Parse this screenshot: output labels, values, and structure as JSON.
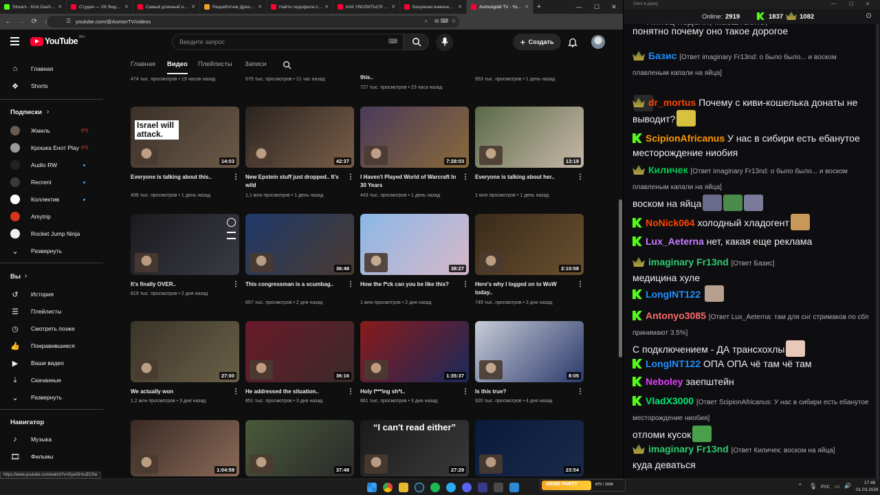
{
  "browser": {
    "tabs": [
      {
        "label": "Stream - Kick Dashboard",
        "color": "#53fc18"
      },
      {
        "label": "Студия — VK Видео Live",
        "color": "#ff0033"
      },
      {
        "label": "Самый длинный нос…",
        "color": "#ff0033"
      },
      {
        "label": "Разработчик Дреи…",
        "color": "#f0a020"
      },
      {
        "label": "Найти педофила по х…",
        "color": "#ff0033"
      },
      {
        "label": "КАК УВОЛИТЬСЯ И П…",
        "color": "#ff0033"
      },
      {
        "label": "Безумная инженерия…",
        "color": "#ff0033"
      },
      {
        "label": "Asmongold TV - YouTube",
        "color": "#ff0033"
      }
    ],
    "url": "youtube.com/@AsmonTV/videos",
    "status_url": "https://www.youtube.com/watch?v=GywSHzuEC0w"
  },
  "yt": {
    "logo": "YouTube",
    "region": "RU",
    "search_placeholder": "Введите запрос",
    "create_label": "Создать",
    "channel_tabs": [
      "Главная",
      "Видео",
      "Плейлисты",
      "Записи"
    ]
  },
  "sidebar": {
    "top": [
      {
        "label": "Главная",
        "icon": "home-icon"
      },
      {
        "label": "Shorts",
        "icon": "shorts-icon"
      }
    ],
    "subs_header": "Подписки",
    "subs": [
      {
        "label": "Жмиль",
        "live": true,
        "color": "#6b5a4e"
      },
      {
        "label": "Крошка Енот Play",
        "live": true,
        "color": "#9a9a9a"
      },
      {
        "label": "Audio RW",
        "dot": true,
        "color": "#222222"
      },
      {
        "label": "Recrent",
        "dot": true,
        "color": "#3a3a3a"
      },
      {
        "label": "Коллектив",
        "dot": true,
        "color": "#ffffff"
      },
      {
        "label": "Amytrip",
        "dot": false,
        "color": "#d4371c"
      },
      {
        "label": "Rocket Jump Ninja",
        "dot": false,
        "color": "#eeeeee"
      },
      {
        "label": "Развернуть",
        "expand": true
      }
    ],
    "you_header": "Вы",
    "you": [
      {
        "label": "История",
        "icon": "history-icon"
      },
      {
        "label": "Плейлисты",
        "icon": "playlists-icon"
      },
      {
        "label": "Смотреть позже",
        "icon": "watch-later-icon"
      },
      {
        "label": "Понравившиеся",
        "icon": "like-icon"
      },
      {
        "label": "Ваши видео",
        "icon": "your-videos-icon"
      },
      {
        "label": "Скачанные",
        "icon": "download-icon"
      },
      {
        "label": "Развернуть",
        "icon": "chevron-down-icon"
      }
    ],
    "nav_header": "Навигатор",
    "nav": [
      {
        "label": "Музыка",
        "icon": "music-icon"
      },
      {
        "label": "Фильмы",
        "icon": "movies-icon"
      }
    ]
  },
  "videos": {
    "row0": [
      {
        "meta": "474 тыс. просмотров • 19 часов назад"
      },
      {
        "meta": "679 тыс. просмотров • 21 час назад"
      },
      {
        "title_tail": "this..",
        "meta": "727 тыс. просмотров • 23 часа назад"
      },
      {
        "meta": "953 тыс. просмотров • 1 день назад"
      }
    ],
    "grid": [
      {
        "title": "Everyone is talking about this..",
        "meta": "499 тыс. просмотров • 1 день назад",
        "duration": "14:03",
        "overlay": "Israel will attack.",
        "bg1": "#3a3028",
        "bg2": "#6b5a48"
      },
      {
        "title": "New Epstein stuff just dropped.. It's wild",
        "meta": "1,1 млн просмотров • 1 день назад",
        "duration": "42:37",
        "overlay": "",
        "bg1": "#2a2420",
        "bg2": "#7a5e48"
      },
      {
        "title": "I Haven't Played World of Warcraft In 30 Years",
        "meta": "443 тыс. просмотров • 1 день назад",
        "duration": "7:28:03",
        "overlay": "",
        "bg1": "#4a3a5a",
        "bg2": "#8a6a3a"
      },
      {
        "title": "Everyone is talking about her..",
        "meta": "1 млн просмотров • 1 день назад",
        "duration": "13:19",
        "overlay": "",
        "bg1": "#5a6a48",
        "bg2": "#c8b8a8"
      },
      {
        "title": "It's finally OVER..",
        "meta": "819 тыс. просмотров • 2 дня назад",
        "duration": "",
        "overlay": "",
        "bg1": "#1a1a1e",
        "bg2": "#3a3a44"
      },
      {
        "title": "This congressman is a scumbag..",
        "meta": "657 тыс. просмотров • 2 дня назад",
        "duration": "36:48",
        "overlay": "",
        "bg1": "#1e3a6a",
        "bg2": "#4a3a30"
      },
      {
        "title": "How the f*ck can you be like this?",
        "meta": "1 млн просмотров • 2 дня назад",
        "duration": "38:27",
        "overlay": "",
        "bg1": "#8ab8e8",
        "bg2": "#d8b8c8"
      },
      {
        "title": "Here's why I logged on to WoW today..",
        "meta": "749 тыс. просмотров • 3 дня назад",
        "duration": "2:10:58",
        "overlay": "",
        "bg1": "#3a2a1a",
        "bg2": "#6a5030"
      },
      {
        "title": "We actually won",
        "meta": "1,2 млн просмотров • 3 дня назад",
        "duration": "27:00",
        "overlay": "",
        "bg1": "#3a3428",
        "bg2": "#6a6048"
      },
      {
        "title": "He addressed the situation..",
        "meta": "851 тыс. просмотров • 3 дня назад",
        "duration": "36:16",
        "overlay": "",
        "bg1": "#6a1a2a",
        "bg2": "#3a2a2a"
      },
      {
        "title": "Holy f***ing sh*t..",
        "meta": "861 тыс. просмотров • 3 дня назад",
        "duration": "1:35:37",
        "overlay": "",
        "bg1": "#8a1a1a",
        "bg2": "#1a2a5a"
      },
      {
        "title": "Is this true?",
        "meta": "920 тыс. просмотров • 4 дня назад",
        "duration": "8:05",
        "overlay": "",
        "bg1": "#c8ccd8",
        "bg2": "#2a3a6a"
      },
      {
        "title": "",
        "meta": "",
        "duration": "1:04:59",
        "overlay": "",
        "bg1": "#3a2a24",
        "bg2": "#8a6a58"
      },
      {
        "title": "",
        "meta": "",
        "duration": "37:48",
        "overlay": "",
        "bg1": "#4a5a3a",
        "bg2": "#2a2a2a"
      },
      {
        "title": "",
        "meta": "",
        "duration": "27:29",
        "overlay": "“I can't read either”",
        "bg1": "#1a1a1a",
        "bg2": "#3a3a3a"
      },
      {
        "title": "",
        "meta": "",
        "duration": "23:54",
        "overlay": "",
        "bg1": "#0a1a3a",
        "bg2": "#1a2a4a"
      }
    ]
  },
  "chat": {
    "window_title": "Окно в дерку",
    "online_label": "Online:",
    "online_count": "2919",
    "kick_count": "1837",
    "vk_count": "1082",
    "messages": [
      {
        "platform": "none",
        "user": "",
        "color": "#efeff1",
        "reply": "",
        "text": "понятно почему оно такое дорогое",
        "top_text": "Пипец неделя, масштабно,"
      },
      {
        "platform": "vk",
        "user": "Базис",
        "color": "#1e90ff",
        "reply": "[Ответ imaginary Fr13nd: о было было... и воском плавленым капали на яйца]",
        "text": ""
      },
      {
        "platform": "vk",
        "user": "dr_mortus",
        "color": "#ff4500",
        "reply": "",
        "text": "Почему с киви-кошелька донаты не выводит?"
      },
      {
        "platform": "kick",
        "user": "ScipionAfricanus",
        "color": "#ff9900",
        "reply": "",
        "text": "У нас в сибири есть ебанутое месторождение ниобия"
      },
      {
        "platform": "vk",
        "user": "Киличек",
        "color": "#00c853",
        "reply": "[Ответ imaginary Fr13nd: о было было... и воском плавленым капали на яйца]",
        "text": "воском на яйца"
      },
      {
        "platform": "kick",
        "user": "NoNick064",
        "color": "#ff4500",
        "reply": "",
        "text": "холодный хладогент"
      },
      {
        "platform": "kick",
        "user": "Lux_Aeterna",
        "color": "#c77dff",
        "reply": "",
        "text": "нет, какая еще реклама"
      },
      {
        "platform": "vk",
        "user": "imaginary Fr13nd",
        "color": "#2ecc71",
        "reply": "[Ответ Базис]",
        "text": "медицина хуле"
      },
      {
        "platform": "kick",
        "user": "LongINT122",
        "color": "#1e90ff",
        "reply": "",
        "text": ""
      },
      {
        "platform": "kick",
        "user": "Antonyo3085",
        "color": "#ff6b6b",
        "reply": "[Ответ Lux_Aeterna: там для снг стримаков по сбп принимают 3.5%]",
        "text": "С подключением - ДА трансхохлы"
      },
      {
        "platform": "kick",
        "user": "LongINT122",
        "color": "#1e90ff",
        "reply": "",
        "text": "ОПА ОПА чё там чё там"
      },
      {
        "platform": "kick",
        "user": "Neboley",
        "color": "#e040fb",
        "reply": "",
        "text": "заепштейн"
      },
      {
        "platform": "kick",
        "user": "VladX3000",
        "color": "#00e676",
        "reply": "[Ответ ScipionAfricanus: У нас в сибири есть ебанутое месторождение ниобия]",
        "text": "отломи кусок"
      },
      {
        "platform": "vk",
        "user": "imaginary Fr13nd",
        "color": "#2ecc71",
        "reply": "[Ответ Киличек: воском на яйца]",
        "text": "куда деваться"
      }
    ]
  },
  "taskbar": {
    "time": "17:46",
    "date": "01.03.2026",
    "lang": "РУС",
    "meme_party": "MEME PARTY",
    "meme_counter": "875 / 1500"
  }
}
